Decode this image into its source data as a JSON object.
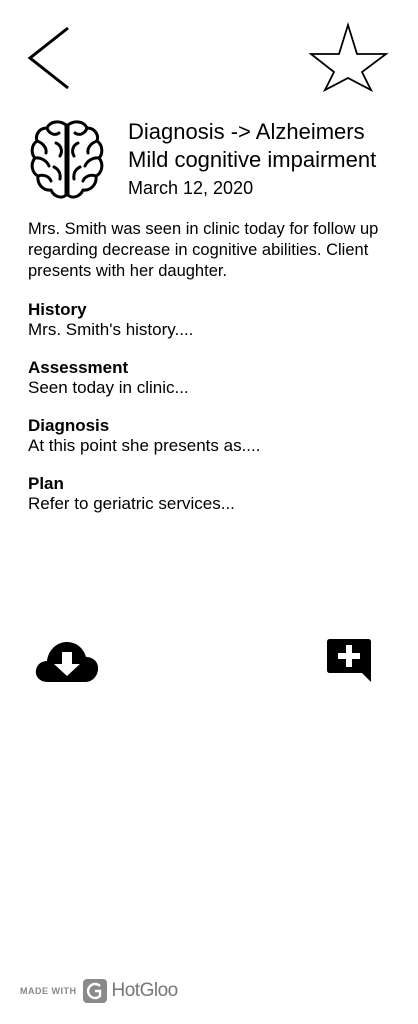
{
  "header": {
    "back_icon": "chevron-left-icon",
    "favorite_icon": "star-outline-icon"
  },
  "note": {
    "icon": "brain-icon",
    "title_line1": "Diagnosis -> Alzheimers",
    "title_line2": "Mild cognitive impairment",
    "date": "March 12, 2020",
    "summary": "Mrs. Smith was seen in clinic today for follow up regarding decrease in cognitive abilities. Client presents with her daughter."
  },
  "sections": [
    {
      "heading": "History",
      "text": "Mrs. Smith's history...."
    },
    {
      "heading": "Assessment",
      "text": "Seen today in clinic..."
    },
    {
      "heading": "Diagnosis",
      "text": "At this point she presents as...."
    },
    {
      "heading": "Plan",
      "text": "Refer to geriatric services..."
    }
  ],
  "actions": {
    "download_icon": "cloud-download-icon",
    "add_note_icon": "add-comment-icon"
  },
  "footer": {
    "made_with": "MADE WITH",
    "brand": "HotGloo"
  }
}
